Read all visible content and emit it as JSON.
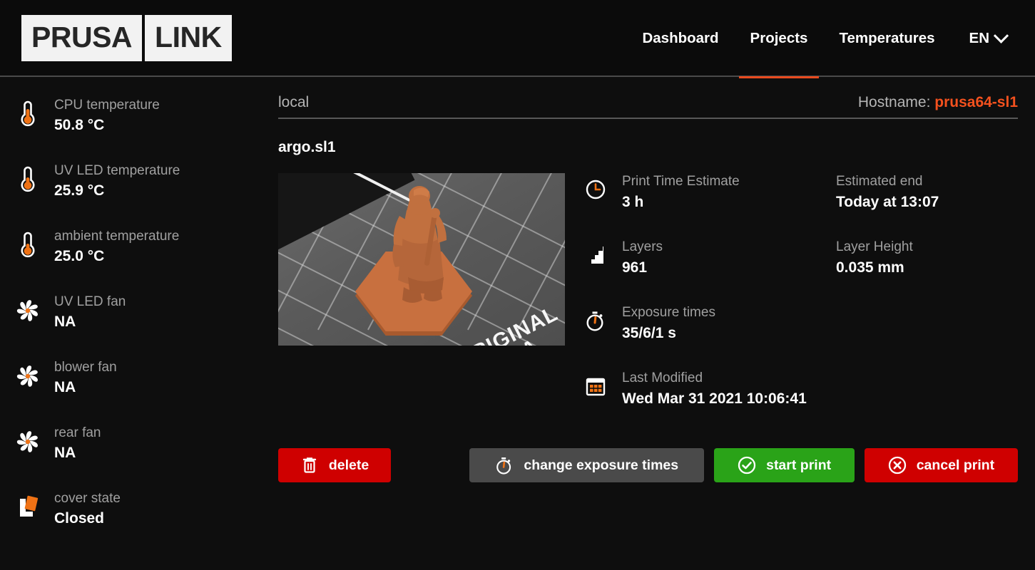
{
  "header": {
    "logo_part1": "PRUSA",
    "logo_part2": "LINK",
    "nav": [
      {
        "label": "Dashboard",
        "active": false
      },
      {
        "label": "Projects",
        "active": true
      },
      {
        "label": "Temperatures",
        "active": false
      }
    ],
    "language": "EN"
  },
  "colors": {
    "accent_orange": "#f4511e",
    "active_underline": "#e8491d",
    "danger_red": "#cf0000",
    "success_green": "#2aa318",
    "neutral_gray": "#4a4a4a",
    "background": "#0e0e0e",
    "label_gray": "#a0a0a0"
  },
  "sidebar": {
    "items": [
      {
        "icon": "thermometer-icon",
        "label": "CPU temperature",
        "value": "50.8 °C"
      },
      {
        "icon": "thermometer-icon",
        "label": "UV LED temperature",
        "value": "25.9 °C"
      },
      {
        "icon": "thermometer-icon",
        "label": "ambient temperature",
        "value": "25.0 °C"
      },
      {
        "icon": "fan-icon",
        "label": "UV LED fan",
        "value": "NA"
      },
      {
        "icon": "fan-icon",
        "label": "blower fan",
        "value": "NA"
      },
      {
        "icon": "fan-icon",
        "label": "rear fan",
        "value": "NA"
      },
      {
        "icon": "cover-icon",
        "label": "cover state",
        "value": "Closed"
      }
    ]
  },
  "main": {
    "breadcrumb": "local",
    "hostname_label": "Hostname: ",
    "hostname_value": "prusa64-sl1",
    "filename": "argo.sl1",
    "thumbnail": {
      "plate_text_line1": "ORIGINAL",
      "plate_text_line2": "PRUSA"
    },
    "metadata": [
      {
        "icon": "clock-icon",
        "label": "Print Time Estimate",
        "value": "3 h"
      },
      {
        "icon": "none",
        "label": "Estimated end",
        "value": "Today at 13:07"
      },
      {
        "icon": "layers-icon",
        "label": "Layers",
        "value": "961"
      },
      {
        "icon": "none",
        "label": "Layer Height",
        "value": "0.035 mm"
      },
      {
        "icon": "stopwatch-icon",
        "label": "Exposure times",
        "value": "35/6/1 s"
      },
      {
        "icon": "none",
        "label": "",
        "value": ""
      },
      {
        "icon": "calendar-icon",
        "label": "Last Modified",
        "value": "Wed Mar 31 2021 10:06:41"
      },
      {
        "icon": "none",
        "label": "",
        "value": ""
      }
    ],
    "buttons": {
      "delete": "delete",
      "change_exposure": "change exposure times",
      "start_print": "start print",
      "cancel_print": "cancel print"
    }
  }
}
